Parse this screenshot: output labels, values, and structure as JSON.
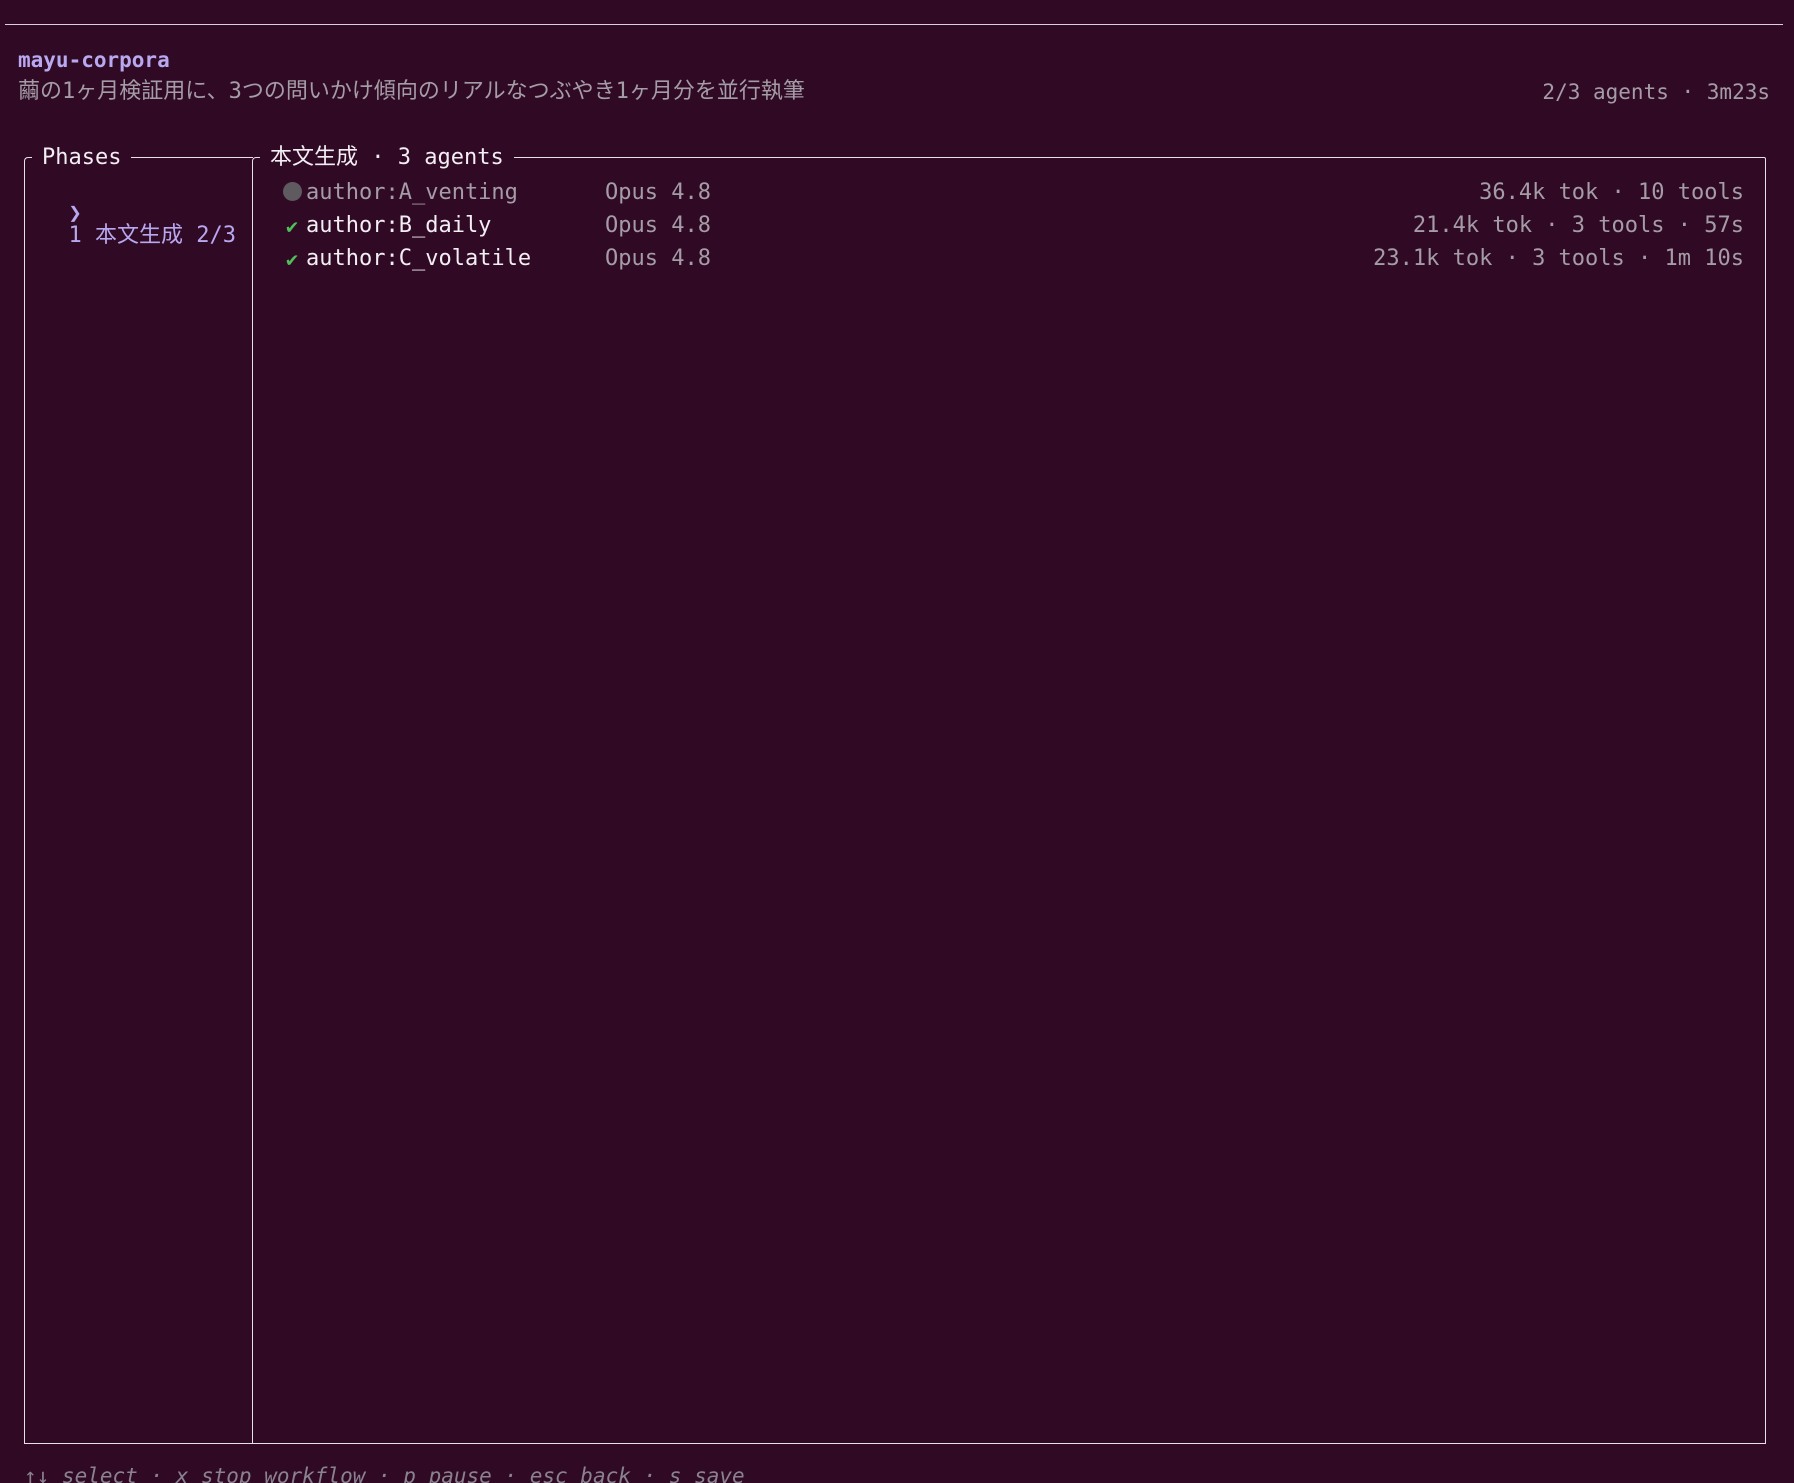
{
  "header": {
    "app_title": "mayu-corpora",
    "subtitle": "繭の1ヶ月検証用に、3つの問いかけ傾向のリアルなつぶやき1ヶ月分を並行執筆",
    "summary": "2/3 agents · 3m23s"
  },
  "phases": {
    "title": "Phases",
    "items": [
      {
        "marker": "❯",
        "label": "1 本文生成 2/3"
      }
    ]
  },
  "main": {
    "title": "本文生成 · 3 agents",
    "agents": [
      {
        "status": "running",
        "name": "author:A_venting",
        "model": "Opus 4.8",
        "stats": "36.4k tok · 10 tools"
      },
      {
        "status": "done",
        "status_glyph": "✔",
        "name": "author:B_daily",
        "model": "Opus 4.8",
        "stats": "21.4k tok · 3 tools · 57s"
      },
      {
        "status": "done",
        "status_glyph": "✔",
        "name": "author:C_volatile",
        "model": "Opus 4.8",
        "stats": "23.1k tok · 3 tools · 1m 10s"
      }
    ]
  },
  "footer": {
    "keybindings": "↑↓ select · x stop workflow · p pause · esc back · s save"
  },
  "colors": {
    "background": "#300a24",
    "accent": "#b8a8f0",
    "success": "#4fbf5a",
    "muted": "#a49ca6"
  }
}
